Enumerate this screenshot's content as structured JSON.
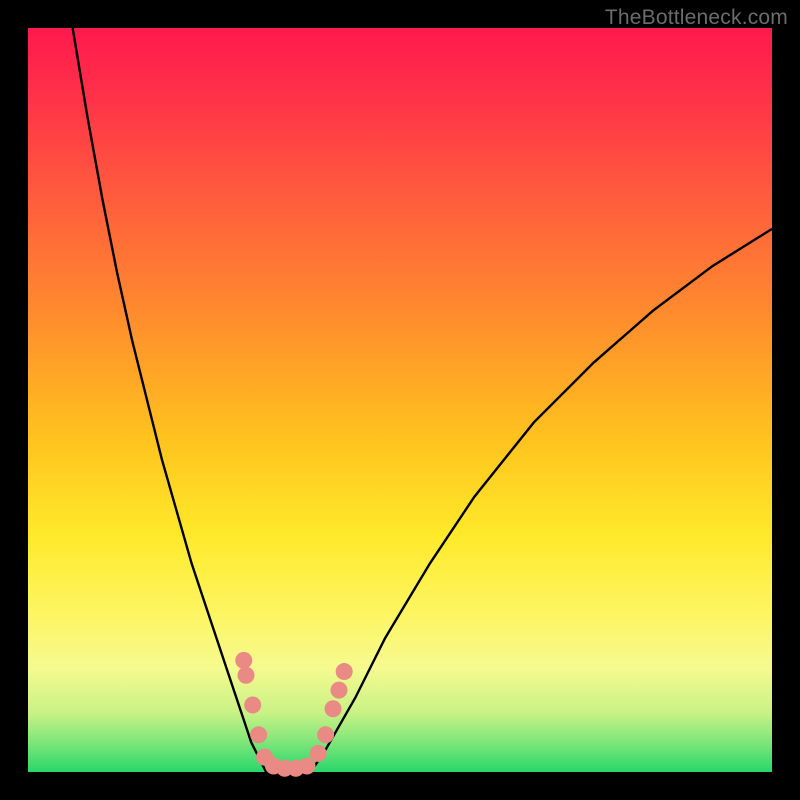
{
  "watermark": "TheBottleneck.com",
  "colors": {
    "frame": "#000000",
    "gradient_top": "#ff1a4d",
    "gradient_mid1": "#ff8a2e",
    "gradient_mid2": "#ffe92a",
    "gradient_bottom": "#28d76a",
    "curve": "#000000",
    "marker": "#e98a84"
  },
  "chart_data": {
    "type": "line",
    "title": "",
    "xlabel": "",
    "ylabel": "",
    "xlim": [
      0,
      100
    ],
    "ylim": [
      0,
      100
    ],
    "series": [
      {
        "name": "left-branch",
        "x": [
          6,
          8,
          10,
          12,
          14,
          16,
          18,
          20,
          22,
          24,
          26,
          28,
          29,
          30,
          31,
          32
        ],
        "y": [
          100,
          88,
          77,
          67,
          58,
          50,
          42,
          35,
          28,
          22,
          16,
          10,
          7,
          4,
          2,
          0
        ]
      },
      {
        "name": "floor",
        "x": [
          32,
          38
        ],
        "y": [
          0,
          0
        ]
      },
      {
        "name": "right-branch",
        "x": [
          38,
          40,
          44,
          48,
          54,
          60,
          68,
          76,
          84,
          92,
          100
        ],
        "y": [
          0,
          3,
          10,
          18,
          28,
          37,
          47,
          55,
          62,
          68,
          73
        ]
      }
    ],
    "markers": {
      "name": "highlight-dots",
      "points": [
        {
          "x": 29.0,
          "y": 15.0
        },
        {
          "x": 29.3,
          "y": 13.0
        },
        {
          "x": 30.2,
          "y": 9.0
        },
        {
          "x": 31.0,
          "y": 5.0
        },
        {
          "x": 31.8,
          "y": 2.0
        },
        {
          "x": 33.0,
          "y": 0.8
        },
        {
          "x": 34.5,
          "y": 0.5
        },
        {
          "x": 36.0,
          "y": 0.5
        },
        {
          "x": 37.5,
          "y": 0.8
        },
        {
          "x": 39.0,
          "y": 2.5
        },
        {
          "x": 40.0,
          "y": 5.0
        },
        {
          "x": 41.0,
          "y": 8.5
        },
        {
          "x": 41.8,
          "y": 11.0
        },
        {
          "x": 42.5,
          "y": 13.5
        }
      ]
    }
  }
}
